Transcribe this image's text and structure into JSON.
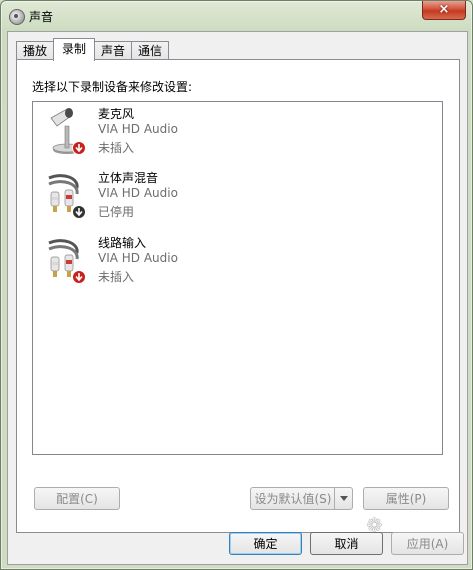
{
  "window": {
    "title": "声音",
    "close_label": "×"
  },
  "tabs": [
    {
      "label": "播放",
      "active": false
    },
    {
      "label": "录制",
      "active": true
    },
    {
      "label": "声音",
      "active": false
    },
    {
      "label": "通信",
      "active": false
    }
  ],
  "recording": {
    "instruction": "选择以下录制设备来修改设置:",
    "devices": [
      {
        "name": "麦克风",
        "driver": "VIA HD Audio",
        "status": "未插入",
        "icon": "microphone-icon",
        "badge": "unplugged-badge-icon"
      },
      {
        "name": "立体声混音",
        "driver": "VIA HD Audio",
        "status": "已停用",
        "icon": "stereo-mix-cable-icon",
        "badge": "disabled-badge-icon"
      },
      {
        "name": "线路输入",
        "driver": "VIA HD Audio",
        "status": "未插入",
        "icon": "line-in-cable-icon",
        "badge": "unplugged-badge-icon"
      }
    ]
  },
  "actions": {
    "configure": "配置(C)",
    "set_default": "设为默认值(S)",
    "properties": "属性(P)"
  },
  "footer": {
    "ok": "确定",
    "cancel": "取消",
    "apply": "应用(A)"
  },
  "colors": {
    "accent_default_border": "#3c7fb1",
    "badge_red": "#c8201c",
    "badge_dark": "#333333",
    "disabled_text": "#8a8a8a",
    "secondary_text": "#6d6d6d"
  }
}
